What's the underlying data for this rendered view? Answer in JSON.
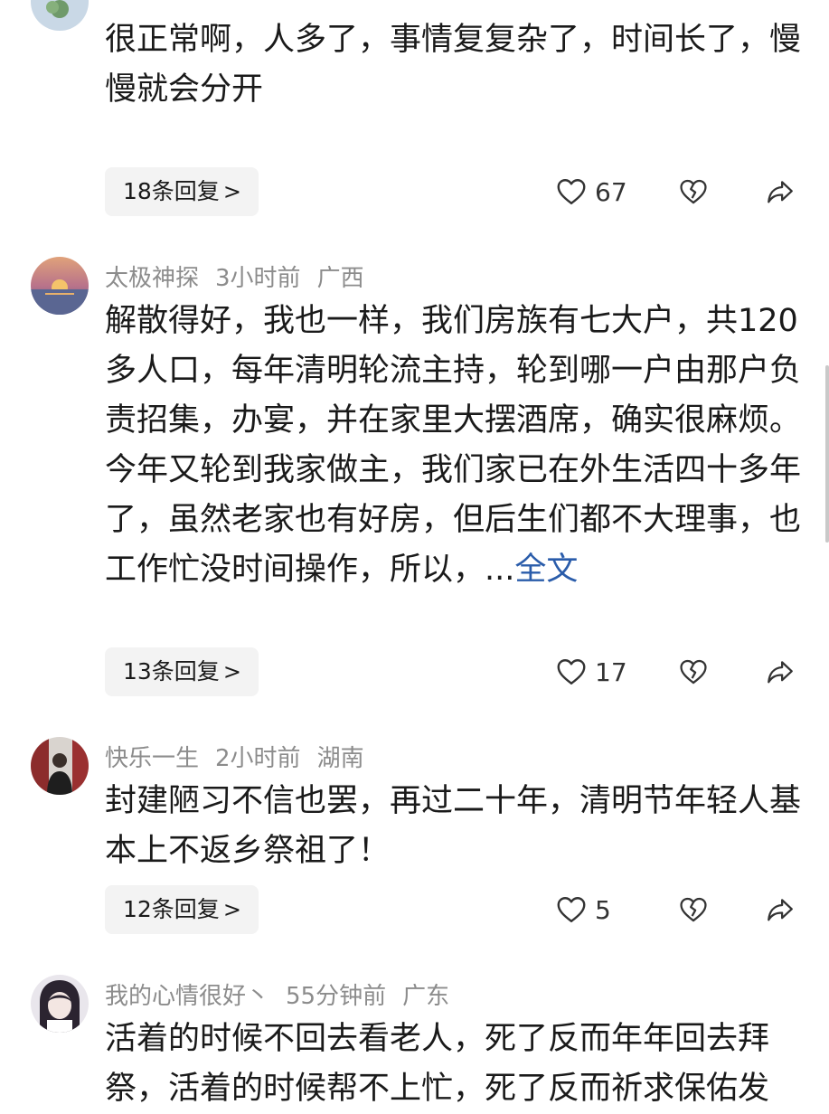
{
  "comments": [
    {
      "text": "很正常啊，人多了，事情复复杂了，时间长了，慢慢就会分开",
      "faint": "",
      "reply_label": "18条回复",
      "likes": "67"
    },
    {
      "username": "太极神探",
      "time": "3小时前",
      "location": "广西",
      "text": "解散得好，我也一样，我们房族有七大户，共120多人口，每年清明轮流主持，轮到哪一户由那户负责招集，办宴，并在家里大摆酒席，确实很麻烦。今年又轮到我家做主，我们家已在外生活四十多年了，虽然老家也有好房，但后生们都不大理事，也工作忙没时间操作，所以，...",
      "more_label": "全文",
      "reply_label": "13条回复",
      "likes": "17"
    },
    {
      "username": "快乐一生",
      "time": "2小时前",
      "location": "湖南",
      "text": "封建陋习不信也罢，再过二十年，清明节年轻人基本上不返乡祭祖了！",
      "reply_label": "12条回复",
      "likes": "5"
    },
    {
      "username": "我的心情很好丶",
      "time": "55分钟前",
      "location": "广东",
      "text": "活着的时候不回去看老人，死了反而年年回去拜祭，活着的时候帮不上忙，死了反而祈求保佑发"
    }
  ],
  "icons": {
    "like": "heart-outline-icon",
    "dislike": "broken-heart-icon",
    "share": "share-arrow-icon",
    "chevron": "chevron-right-icon"
  },
  "colors": {
    "link": "#2a5caa",
    "meta": "#8c8c8c",
    "reply_bg": "#f3f3f3"
  }
}
